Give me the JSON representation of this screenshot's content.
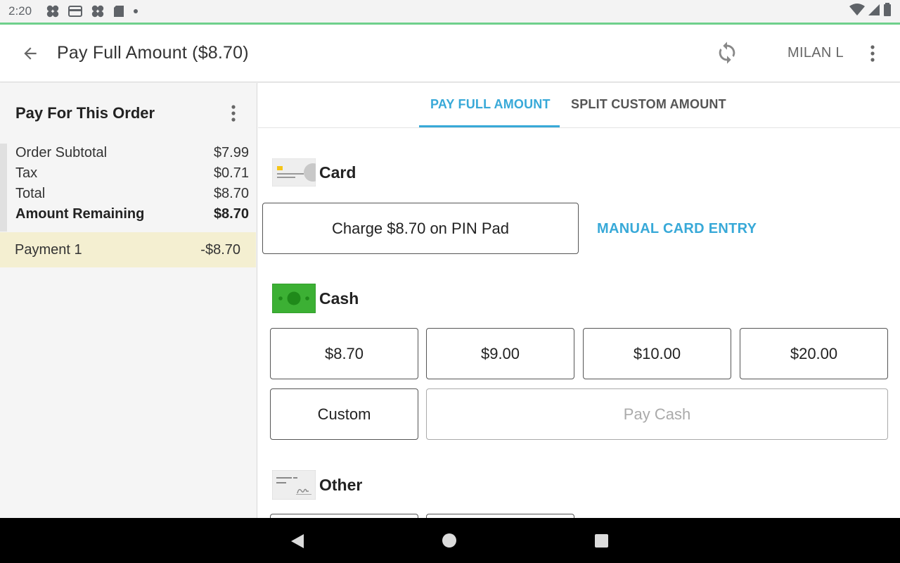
{
  "status_bar": {
    "time": "2:20",
    "icons": [
      "clover-icon",
      "card-icon",
      "clover-icon",
      "sd-card-icon",
      "dot-icon"
    ],
    "right_icons": [
      "wifi-icon",
      "signal-icon",
      "battery-icon"
    ]
  },
  "app_bar": {
    "title": "Pay Full Amount ($8.70)",
    "user": "MILAN L"
  },
  "left_panel": {
    "title": "Pay For This Order",
    "summary": [
      {
        "label": "Order Subtotal",
        "value": "$7.99"
      },
      {
        "label": "Tax",
        "value": "$0.71"
      },
      {
        "label": "Total",
        "value": "$8.70"
      },
      {
        "label": "Amount Remaining",
        "value": "$8.70"
      }
    ],
    "payment": {
      "label": "Payment 1",
      "value": "-$8.70"
    }
  },
  "tabs": {
    "active": "PAY FULL AMOUNT",
    "inactive": "SPLIT CUSTOM AMOUNT"
  },
  "card_section": {
    "title": "Card",
    "charge_label": "Charge $8.70 on PIN Pad",
    "manual_label": "MANUAL CARD ENTRY"
  },
  "cash_section": {
    "title": "Cash",
    "amounts": [
      "$8.70",
      "$9.00",
      "$10.00",
      "$20.00"
    ],
    "custom_label": "Custom",
    "pay_cash_label": "Pay Cash"
  },
  "other_section": {
    "title": "Other"
  },
  "colors": {
    "accent": "#38a9d8",
    "status_accent": "#6fd08c",
    "cash_green": "#3cb034",
    "payment_highlight": "#f4efd1"
  }
}
